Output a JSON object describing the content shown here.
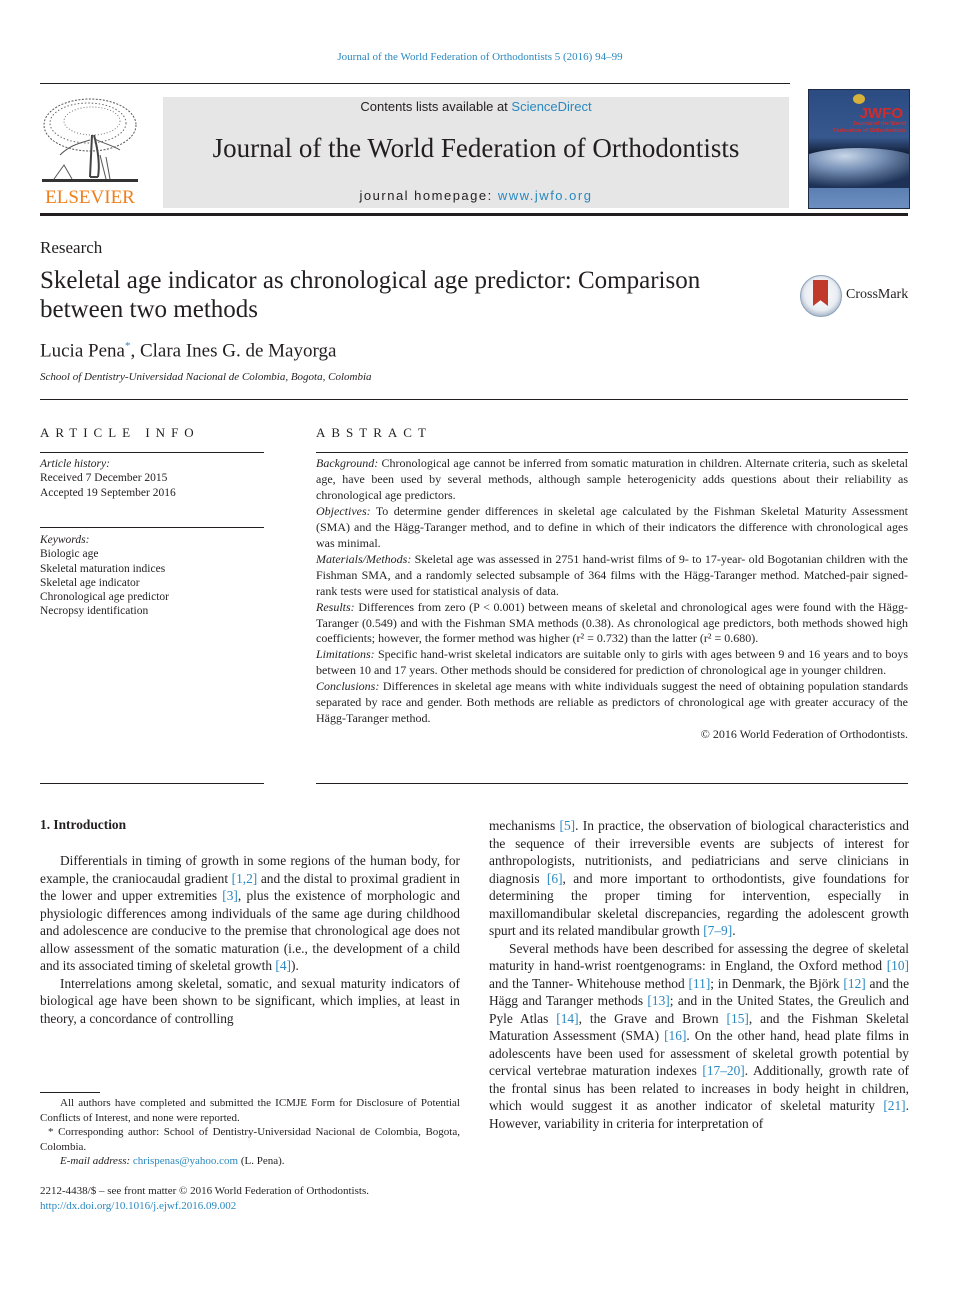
{
  "running_head": "Journal of the World Federation of Orthodontists 5 (2016) 94–99",
  "publisher": {
    "logo_text": "ELSEVIER",
    "logo_icon": "elsevier-tree-icon",
    "colors": {
      "logo": "#f07f1b",
      "link": "#2a88c0",
      "banner_bg": "#e6e6e6"
    }
  },
  "banner": {
    "contents_prefix": "Contents lists available at ",
    "contents_link": "ScienceDirect",
    "journal_name": "Journal of the World Federation of Orthodontists",
    "homepage_prefix": "journal homepage: ",
    "homepage_link": "www.jwfo.org"
  },
  "cover": {
    "acronym": "JWFO",
    "line1": "Journal of the World",
    "line2": "Federation of Orthodontists"
  },
  "article": {
    "section": "Research",
    "title": "Skeletal age indicator as chronological age predictor: Comparison between two methods",
    "crossmark_label": "CrossMark",
    "authors": [
      {
        "name": "Lucia Pena",
        "mark": "*"
      },
      {
        "name": "Clara Ines G. de Mayorga",
        "mark": ""
      }
    ],
    "author_separator": ", ",
    "affiliation": "School of Dentistry-Universidad Nacional de Colombia, Bogota, Colombia"
  },
  "article_info": {
    "heading": "ARTICLE INFO",
    "history_label": "Article history:",
    "received": "Received 7 December 2015",
    "accepted": "Accepted 19 September 2016",
    "keywords_label": "Keywords:",
    "keywords": [
      "Biologic age",
      "Skeletal maturation indices",
      "Skeletal age indicator",
      "Chronological age predictor",
      "Necropsy identification"
    ]
  },
  "abstract": {
    "heading": "ABSTRACT",
    "sections": [
      {
        "label": "Background:",
        "text": " Chronological age cannot be inferred from somatic maturation in children. Alternate criteria, such as skeletal age, have been used by several methods, although sample heterogenicity adds questions about their reliability as chronological age predictors."
      },
      {
        "label": "Objectives:",
        "text": " To determine gender differences in skeletal age calculated by the Fishman Skeletal Maturity Assessment (SMA) and the Hägg-Taranger method, and to define in which of their indicators the difference with chronological ages was minimal."
      },
      {
        "label": "Materials/Methods:",
        "text": " Skeletal age was assessed in 2751 hand-wrist films of 9- to 17-year- old Bogotanian children with the Fishman SMA, and a randomly selected subsample of 364 films with the Hägg-Taranger method. Matched-pair signed-rank tests were used for statistical analysis of data."
      },
      {
        "label": "Results:",
        "text": " Differences from zero (P < 0.001) between means of skeletal and chronological ages were found with the Hägg-Taranger (0.549) and with the Fishman SMA methods (0.38). As chronological age predictors, both methods showed high coefficients; however, the former method was higher (r² = 0.732) than the latter (r² = 0.680)."
      },
      {
        "label": "Limitations:",
        "text": " Specific hand-wrist skeletal indicators are suitable only to girls with ages between 9 and 16 years and to boys between 10 and 17 years. Other methods should be considered for prediction of chronological age in younger children."
      },
      {
        "label": "Conclusions:",
        "text": " Differences in skeletal age means with white individuals suggest the need of obtaining population standards separated by race and gender. Both methods are reliable as predictors of chronological age with greater accuracy of the Hägg-Taranger method."
      }
    ],
    "copyright": "© 2016 World Federation of Orthodontists."
  },
  "body": {
    "intro_heading": "1.  Introduction",
    "left_paragraphs": [
      [
        {
          "t": "Differentials in timing of growth in some regions of the human body, for example, the craniocaudal gradient "
        },
        {
          "ref": "[1,2]"
        },
        {
          "t": " and the distal to proximal gradient in the lower and upper extremities "
        },
        {
          "ref": "[3]"
        },
        {
          "t": ", plus the existence of morphologic and physiologic differences among individuals of the same age during childhood and adolescence are conducive to the premise that chronological age does not allow assessment of the somatic maturation (i.e., the development of a child and its associated timing of skeletal growth "
        },
        {
          "ref": "[4]"
        },
        {
          "t": ")."
        }
      ],
      [
        {
          "t": "Interrelations among skeletal, somatic, and sexual maturity indicators of biological age have been shown to be significant, which implies, at least in theory, a concordance of controlling"
        }
      ]
    ],
    "right_paragraphs": [
      [
        {
          "t": "mechanisms "
        },
        {
          "ref": "[5]"
        },
        {
          "t": ". In practice, the observation of biological characteristics and the sequence of their irreversible events are subjects of interest for anthropologists, nutritionists, and pediatricians and serve clinicians in diagnosis "
        },
        {
          "ref": "[6]"
        },
        {
          "t": ", and more important to orthodontists, give foundations for determining the proper timing for intervention, especially in maxillomandibular skeletal discrepancies, regarding the adolescent growth spurt and its related mandibular growth "
        },
        {
          "ref": "[7–9]"
        },
        {
          "t": "."
        }
      ],
      [
        {
          "t": "Several methods have been described for assessing the degree of skeletal maturity in hand-wrist roentgenograms: in England, the Oxford method "
        },
        {
          "ref": "[10]"
        },
        {
          "t": " and the Tanner- Whitehouse method "
        },
        {
          "ref": "[11]"
        },
        {
          "t": "; in Denmark, the Björk "
        },
        {
          "ref": "[12]"
        },
        {
          "t": " and the Hägg and Taranger methods "
        },
        {
          "ref": "[13]"
        },
        {
          "t": "; and in the United States, the Greulich and Pyle Atlas "
        },
        {
          "ref": "[14]"
        },
        {
          "t": ", the Grave and Brown "
        },
        {
          "ref": "[15]"
        },
        {
          "t": ", and the Fishman Skeletal Maturation Assessment (SMA) "
        },
        {
          "ref": "[16]"
        },
        {
          "t": ". On the other hand, head plate films in adolescents have been used for assessment of skeletal growth potential by cervical vertebrae maturation indexes "
        },
        {
          "ref": "[17–20]"
        },
        {
          "t": ". Additionally, growth rate of the frontal sinus has been related to increases in body height in children, which would suggest it as another indicator of skeletal maturity "
        },
        {
          "ref": "[21]"
        },
        {
          "t": ". However, variability in criteria for interpretation of"
        }
      ]
    ]
  },
  "footnotes": {
    "disclosure": "All authors have completed and submitted the ICMJE Form for Disclosure of Potential Conflicts of Interest, and none were reported.",
    "corresponding": "* Corresponding author: School of Dentistry-Universidad Nacional de Colombia, Bogota, Colombia.",
    "email_label": "E-mail address:",
    "email": "chrispenas@yahoo.com",
    "email_suffix": " (L. Pena)."
  },
  "front_matter": {
    "issn_line": "2212-4438/$ – see front matter © 2016 World Federation of Orthodontists.",
    "doi": "http://dx.doi.org/10.1016/j.ejwf.2016.09.002"
  }
}
